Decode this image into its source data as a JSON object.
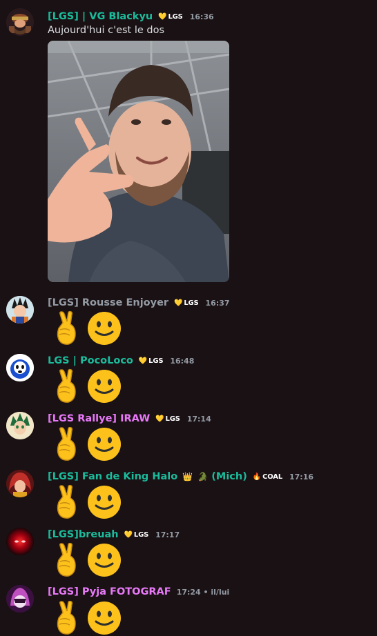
{
  "messages": [
    {
      "author": "[LGS] | VG Blackyu",
      "author_color": "#1abc9c",
      "tag": "LGS",
      "tag_icon": "yellow-heart-icon",
      "time": "16:36",
      "text": "Aujourd'hui c'est le dos",
      "avatar": "dwarf-warrior-avatar",
      "attachment": "selfie-photo"
    },
    {
      "author": "[LGS] Rousse Enjoyer",
      "author_color": "#949ba4",
      "tag": "LGS",
      "tag_icon": "yellow-heart-icon",
      "time": "16:37",
      "emojis": [
        "victory-hand-icon",
        "slightly-smiling-face-icon"
      ],
      "avatar": "anime-boy-avatar"
    },
    {
      "author": "LGS | PocoLoco",
      "author_color": "#1abc9c",
      "tag": "LGS",
      "tag_icon": "yellow-heart-icon",
      "time": "16:48",
      "emojis": [
        "victory-hand-icon",
        "slightly-smiling-face-icon"
      ],
      "avatar": "blue-masked-avatar"
    },
    {
      "author": "[LGS Rallye] IRAW",
      "author_color": "#e879f9",
      "tag": "LGS",
      "tag_icon": "yellow-heart-icon",
      "time": "17:14",
      "emojis": [
        "victory-hand-icon",
        "slightly-smiling-face-icon"
      ],
      "avatar": "green-hair-hero-avatar"
    },
    {
      "author": "[LGS] Fan de King Halo",
      "author_suffix": "(Mich)",
      "author_color": "#1abc9c",
      "tag": "COAL",
      "tag_icon": "fire-icon",
      "time": "17:16",
      "emojis": [
        "victory-hand-icon",
        "slightly-smiling-face-icon"
      ],
      "avatar": "red-hair-avatar"
    },
    {
      "author": "[LGS]breuah",
      "author_color": "#1abc9c",
      "tag": "LGS",
      "tag_icon": "yellow-heart-icon",
      "time": "17:17",
      "emojis": [
        "victory-hand-icon",
        "slightly-smiling-face-icon"
      ],
      "avatar": "red-glow-avatar"
    },
    {
      "author": "[LGS] Pyja FOTOGRAF",
      "author_color": "#e879f9",
      "time": "17:24 • il/lui",
      "emojis": [
        "victory-hand-icon",
        "slightly-smiling-face-icon"
      ],
      "avatar": "purple-masked-avatar"
    }
  ],
  "colors": {
    "background": "#1a1114",
    "timestamp": "#949ba4",
    "text": "#dbdee1"
  }
}
